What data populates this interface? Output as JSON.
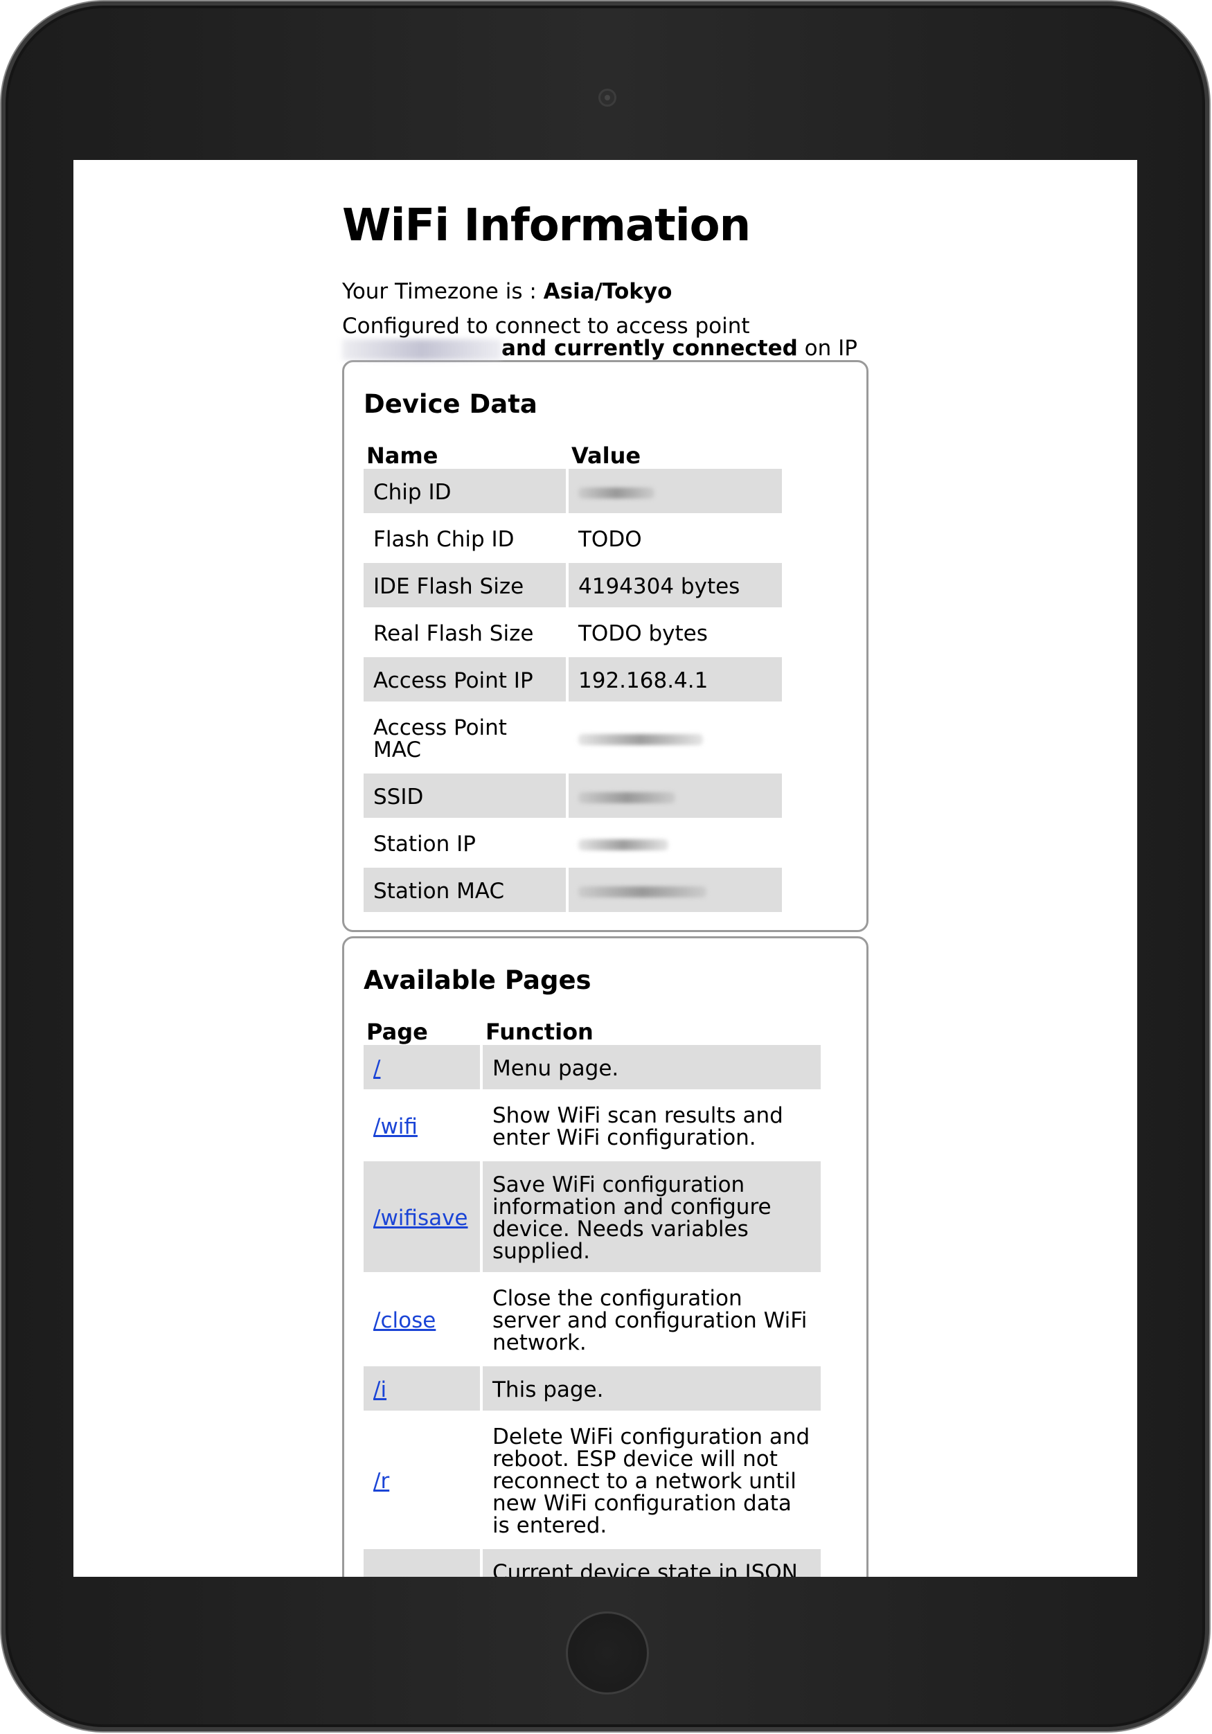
{
  "page": {
    "title": "WiFi Information",
    "timezone_prefix": "Your Timezone is : ",
    "timezone_value": "Asia/Tokyo",
    "config_line1": "Configured to connect to access point",
    "config_bold": "and currently connected",
    "config_suffix": " on IP"
  },
  "device_data": {
    "heading": "Device Data",
    "col_name": "Name",
    "col_value": "Value",
    "rows": [
      {
        "name": "Chip ID",
        "value": ""
      },
      {
        "name": "Flash Chip ID",
        "value": "TODO"
      },
      {
        "name": "IDE Flash Size",
        "value": "4194304 bytes"
      },
      {
        "name": "Real Flash Size",
        "value": "TODO bytes"
      },
      {
        "name": "Access Point IP",
        "value": "192.168.4.1"
      },
      {
        "name": "Access Point MAC",
        "value": ""
      },
      {
        "name": "SSID",
        "value": ""
      },
      {
        "name": "Station IP",
        "value": ""
      },
      {
        "name": "Station MAC",
        "value": ""
      }
    ]
  },
  "available_pages": {
    "heading": "Available Pages",
    "col_page": "Page",
    "col_function": "Function",
    "rows": [
      {
        "page": "/",
        "function": "Menu page."
      },
      {
        "page": "/wifi",
        "function": "Show WiFi scan results and enter WiFi configuration."
      },
      {
        "page": "/wifisave",
        "function": "Save WiFi configuration information and configure device. Needs variables supplied."
      },
      {
        "page": "/close",
        "function": "Close the configuration server and configuration WiFi network."
      },
      {
        "page": "/i",
        "function": "This page."
      },
      {
        "page": "/r",
        "function": "Delete WiFi configuration and reboot. ESP device will not reconnect to a network until new WiFi configuration data is entered."
      },
      {
        "page": "",
        "function": "Current device state in JSON"
      }
    ]
  },
  "colors": {
    "link": "#1a44d6",
    "row_shade": "#dddddd",
    "panel_border": "#9a9a9a"
  }
}
